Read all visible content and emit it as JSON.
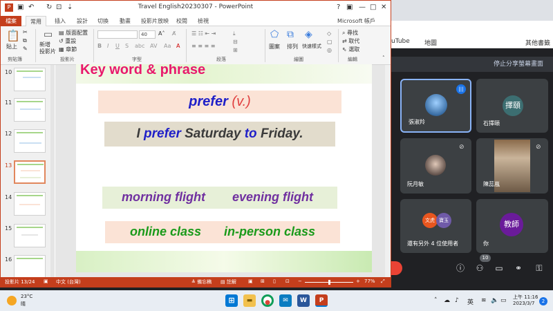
{
  "browser": {
    "bookmarks": {
      "youtube": "uTube",
      "map": "地圖",
      "other": "其他書籤"
    },
    "avatar": "教師"
  },
  "meet": {
    "stop_share": "停止分享螢幕畫面",
    "participants": [
      {
        "name": "張淑羚"
      },
      {
        "name": "石擇頤",
        "initials": "擇頤"
      },
      {
        "name": "阮月敏"
      },
      {
        "name": "陳蕊嵐"
      },
      {
        "name": "還有另外 4 位使用者",
        "initials_a": "文虎",
        "initials_b": "寶玉"
      },
      {
        "name": "你",
        "initials": "教師"
      }
    ],
    "people_count": "10"
  },
  "ppt": {
    "window_title": "Travel English20230307 - PowerPoint",
    "user": "Microsoft 帳戶",
    "tabs": [
      "檔案",
      "常用",
      "插入",
      "設計",
      "切換",
      "動畫",
      "投影片放映",
      "校閱",
      "檢視"
    ],
    "ribbon": {
      "paste": "貼上",
      "clipboard": "剪貼簿",
      "new_slide": "新增\n投影片",
      "layout": "版面配置",
      "reset": "重設",
      "section": "章節",
      "slides_group": "投影片",
      "font_group": "字型",
      "paragraph_group": "段落",
      "shapes": "圖案",
      "arrange": "排列",
      "quick_styles": "快速樣式",
      "drawing_group": "繪圖",
      "find": "尋找",
      "replace": "取代",
      "select": "選取",
      "editing_group": "編輯",
      "font_size": "40"
    },
    "thumbnails": [
      {
        "num": "10"
      },
      {
        "num": "11"
      },
      {
        "num": "12"
      },
      {
        "num": "13"
      },
      {
        "num": "14"
      },
      {
        "num": "15"
      },
      {
        "num": "16"
      }
    ],
    "slide": {
      "title": "Key word & phrase",
      "word": "prefer",
      "pos": "(v.)",
      "sentence_a": "I ",
      "sentence_b": "prefer",
      "sentence_c": " Saturday ",
      "sentence_d": "to",
      "sentence_e": " Friday.",
      "phrase1": "morning flight",
      "phrase2": "evening flight",
      "phrase3": "online class",
      "phrase4": "in-person class"
    },
    "status": {
      "slide_pos": "投影片 13/24",
      "language": "中文 (台灣)",
      "notes": "備忘稿",
      "comments": "註解",
      "zoom": "77%"
    }
  },
  "taskbar": {
    "temp": "23°C",
    "condition": "晴",
    "ime": "英",
    "time": "上午 11:16",
    "date": "2023/3/7",
    "notifications": "2"
  },
  "colors": {
    "ppt_accent": "#c43e1c",
    "title_pink": "#e8196c",
    "blue": "#1f1fc8",
    "purple": "#7030a0",
    "green": "#1a9a1a"
  }
}
